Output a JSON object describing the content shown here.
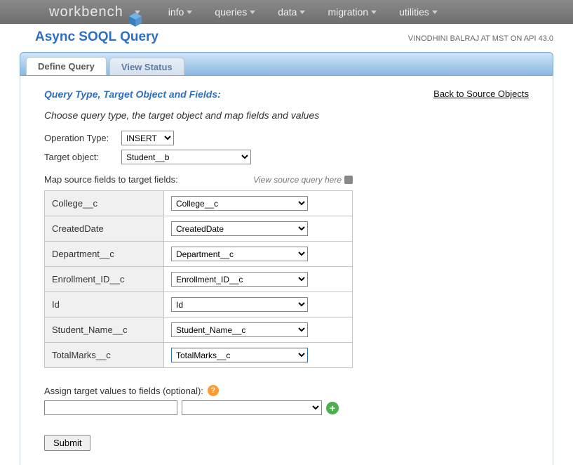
{
  "nav": {
    "brand": "workbench",
    "items": [
      "info",
      "queries",
      "data",
      "migration",
      "utilities"
    ]
  },
  "page_title": "Async SOQL Query",
  "userline": "VINODHINI BALRAJ AT MST ON API 43.0",
  "tabs": {
    "define": "Define Query",
    "view_status": "View Status"
  },
  "back_link": "Back to Source Objects",
  "section": {
    "title": "Query Type, Target Object and Fields:",
    "desc": "Choose query type, the target object and map fields and values",
    "op_label": "Operation Type:",
    "op_value": "INSERT",
    "target_label": "Target object:",
    "target_value": "Student__b",
    "map_label": "Map source fields to target fields:",
    "view_source_query": "View source query here",
    "mappings": [
      {
        "src": "College__c",
        "dst": "College__c"
      },
      {
        "src": "CreatedDate",
        "dst": "CreatedDate"
      },
      {
        "src": "Department__c",
        "dst": "Department__c"
      },
      {
        "src": "Enrollment_ID__c",
        "dst": "Enrollment_ID__c"
      },
      {
        "src": "Id",
        "dst": "Id"
      },
      {
        "src": "Student_Name__c",
        "dst": "Student_Name__c"
      },
      {
        "src": "TotalMarks__c",
        "dst": "TotalMarks__c"
      }
    ],
    "highlighted_row": 6,
    "assign_label": "Assign target values to fields (optional):",
    "assign_field_value": "",
    "assign_select_value": "",
    "submit_label": "Submit"
  }
}
